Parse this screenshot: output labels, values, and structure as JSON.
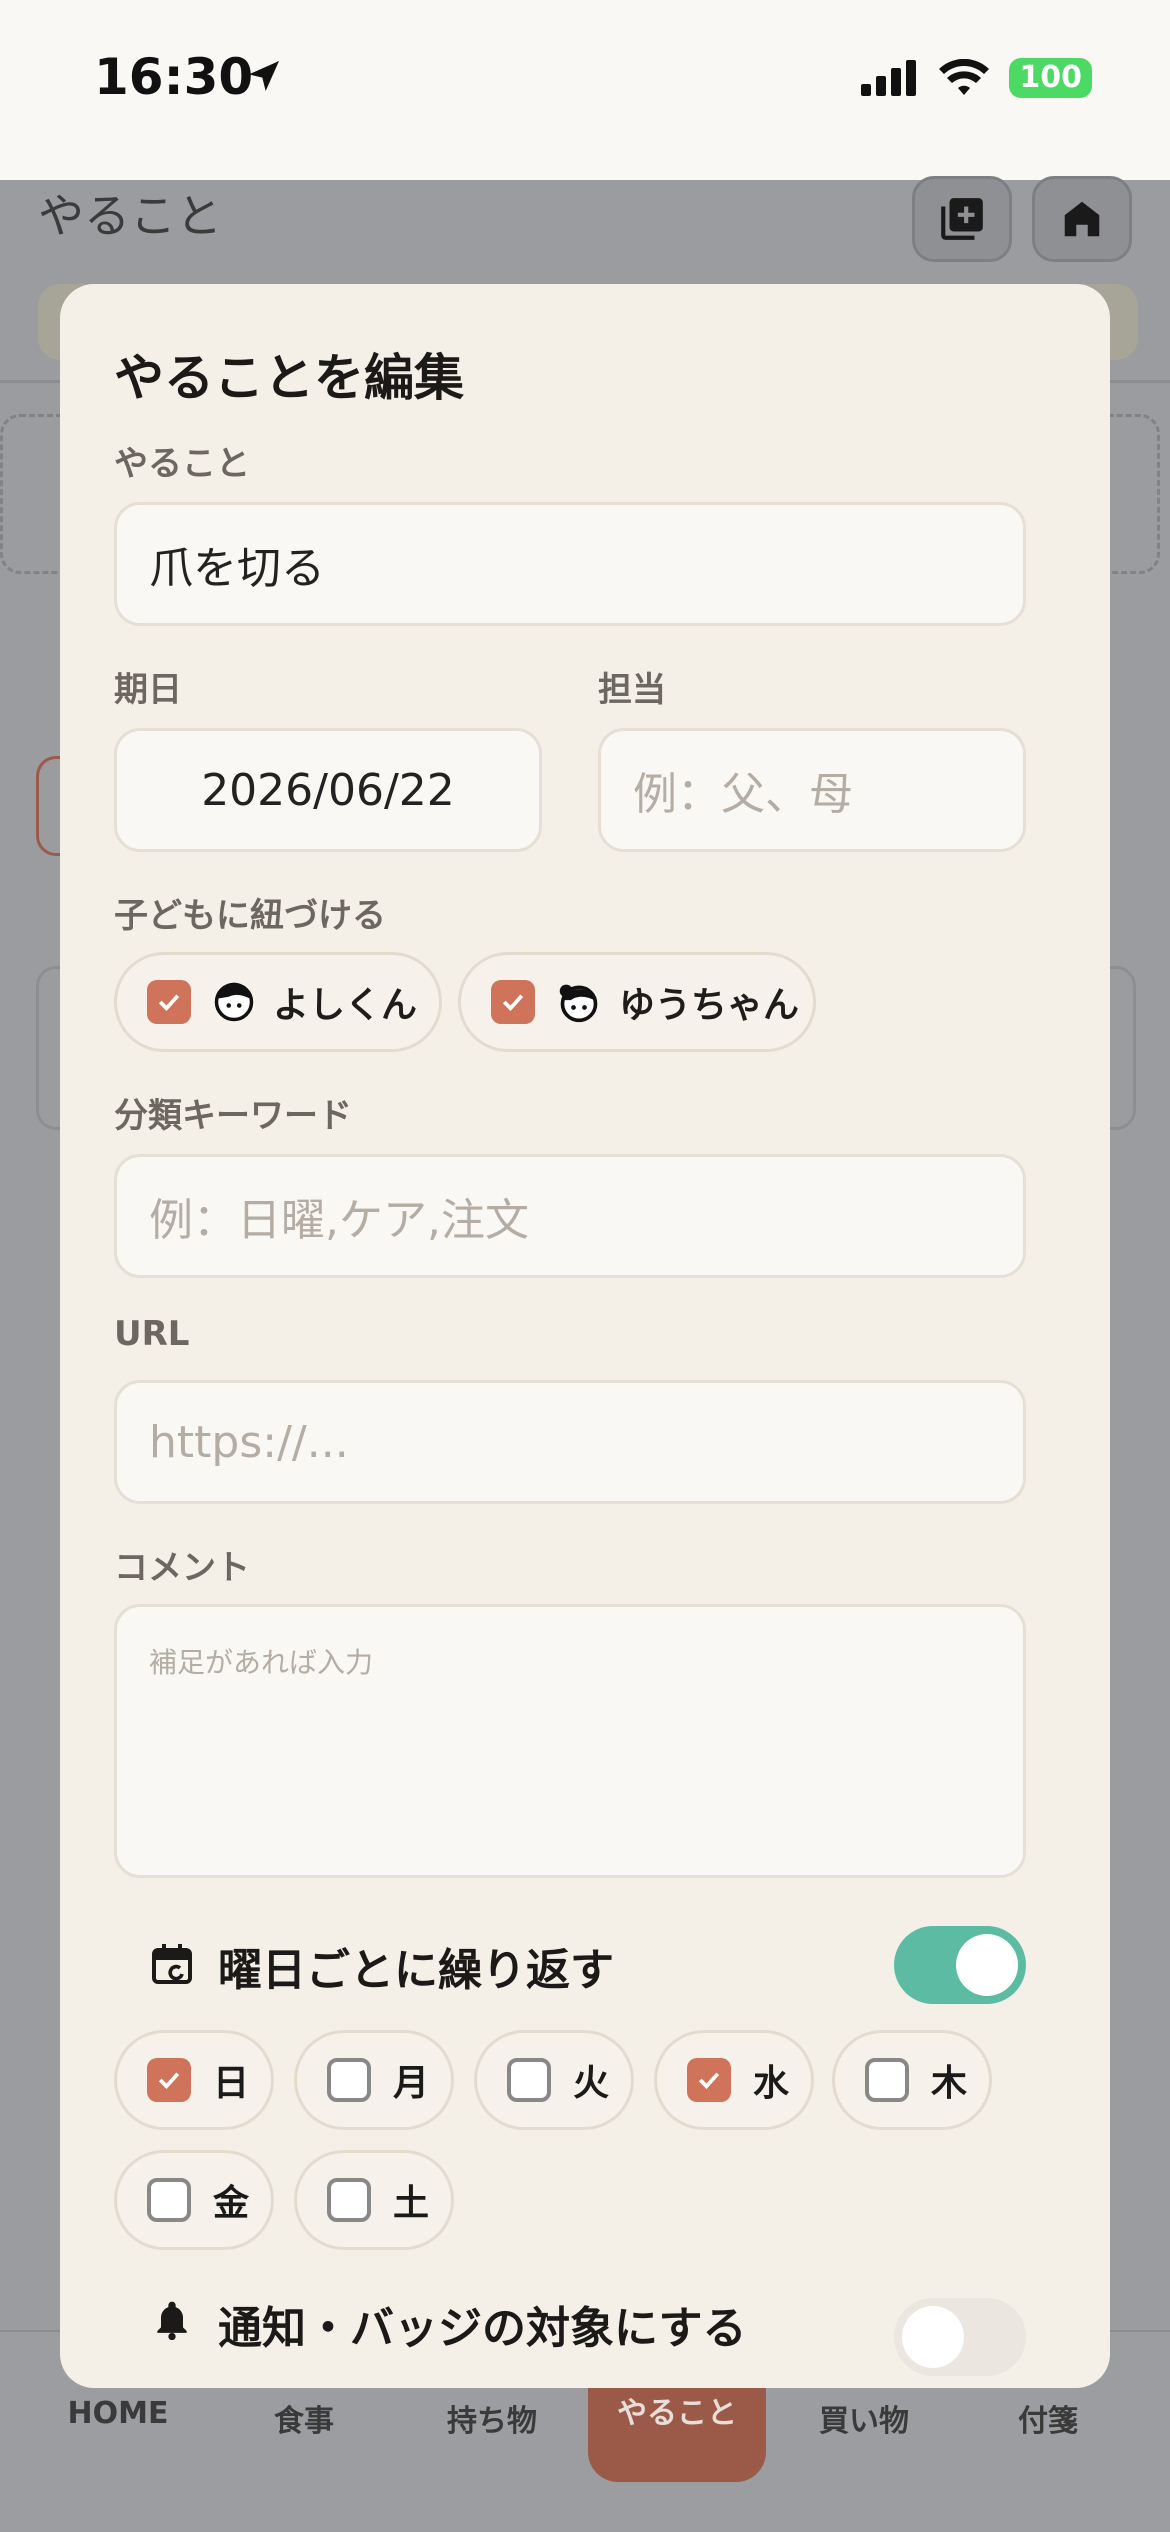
{
  "status_bar": {
    "time": "16:30",
    "battery": "100"
  },
  "background": {
    "page_title": "やること",
    "tab_bar": [
      {
        "label": "HOME",
        "icon": "house-icon"
      },
      {
        "label": "食事",
        "icon": "utensils-icon"
      },
      {
        "label": "持ち物",
        "icon": "checklist-icon"
      },
      {
        "label": "やること",
        "icon": "check-circle-icon",
        "active": true
      },
      {
        "label": "買い物",
        "icon": "cart-icon"
      },
      {
        "label": "付箋",
        "icon": "note-icon"
      }
    ]
  },
  "modal": {
    "title": "やることを編集",
    "task": {
      "label": "やること",
      "value": "爪を切る"
    },
    "due": {
      "label": "期日",
      "value": "2026/06/22"
    },
    "assignee": {
      "label": "担当",
      "placeholder": "例：父、母"
    },
    "children": {
      "label": "子どもに紐づける",
      "items": [
        {
          "name": "よしくん",
          "checked": true
        },
        {
          "name": "ゆうちゃん",
          "checked": true
        }
      ]
    },
    "keywords": {
      "label": "分類キーワード",
      "placeholder": "例：日曜,ケア,注文"
    },
    "url": {
      "label": "URL",
      "placeholder": "https://..."
    },
    "comment": {
      "label": "コメント",
      "placeholder": "補足があれば入力"
    },
    "repeat": {
      "label": "曜日ごとに繰り返す",
      "enabled": true,
      "days": [
        {
          "label": "日",
          "checked": true
        },
        {
          "label": "月",
          "checked": false
        },
        {
          "label": "火",
          "checked": false
        },
        {
          "label": "水",
          "checked": true
        },
        {
          "label": "木",
          "checked": false
        },
        {
          "label": "金",
          "checked": false
        },
        {
          "label": "土",
          "checked": false
        }
      ]
    },
    "notify": {
      "label": "通知・バッジの対象にする",
      "enabled": false
    }
  },
  "colors": {
    "accent": "#cf735a",
    "toggle_on": "#5bbca3",
    "toggle_off": "#ebe6df",
    "modal_bg": "#f4efe7"
  }
}
